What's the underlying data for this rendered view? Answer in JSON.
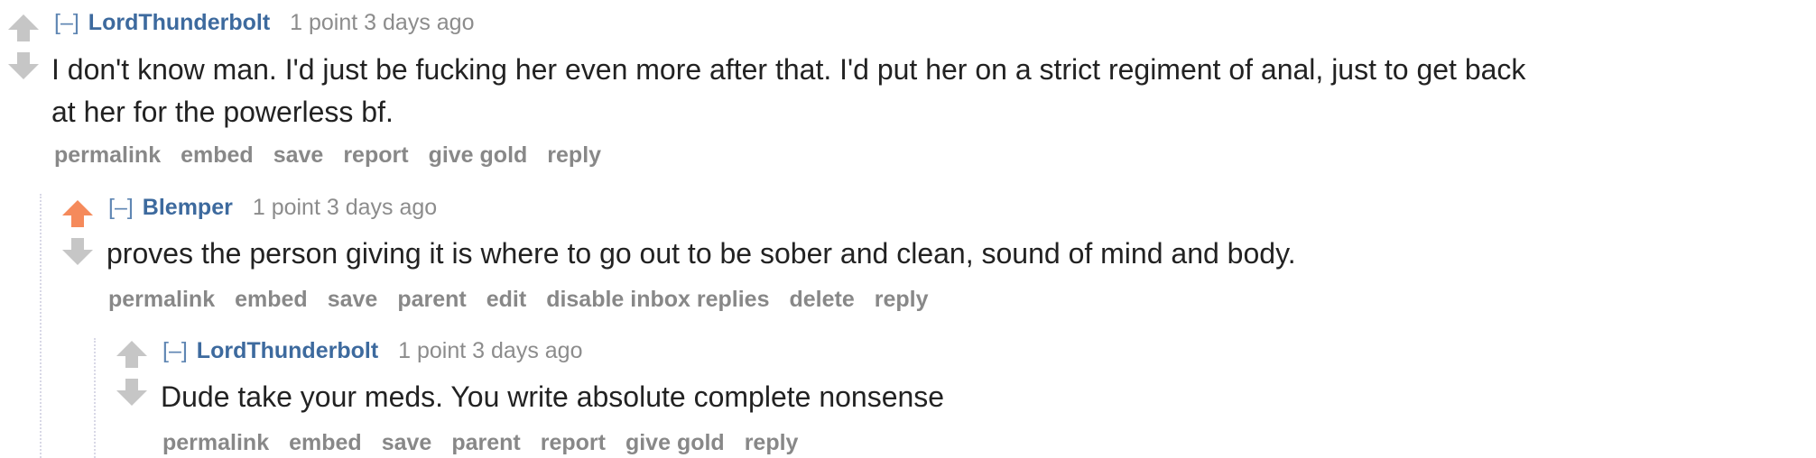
{
  "colors": {
    "upvoted_arrow": "#f58a5b",
    "arrow_gray": "#c6c6c6",
    "author_blue": "#3d6a9e",
    "expand_blue": "#5f86b3",
    "meta_gray": "#8c8c8c",
    "button_gray": "#888888",
    "thread_line": "#d8d8e6"
  },
  "comments": [
    {
      "expand": "[–]",
      "author": "LordThunderbolt",
      "score": "1 point",
      "time": "3 days ago",
      "body_line1": "I don't know man. I'd just be fucking her even more after that. I'd put her on a strict regiment of anal, just to get back",
      "body_line2": "at her for the powerless bf.",
      "upvoted": false,
      "buttons": [
        "permalink",
        "embed",
        "save",
        "report",
        "give gold",
        "reply"
      ]
    },
    {
      "expand": "[–]",
      "author": "Blemper",
      "score": "1 point",
      "time": "3 days ago",
      "body_line1": "proves the person giving it is where to go out to be sober and clean, sound of mind and body.",
      "upvoted": true,
      "buttons": [
        "permalink",
        "embed",
        "save",
        "parent",
        "edit",
        "disable inbox replies",
        "delete",
        "reply"
      ]
    },
    {
      "expand": "[–]",
      "author": "LordThunderbolt",
      "score": "1 point",
      "time": "3 days ago",
      "body_line1": "Dude take your meds. You write absolute complete nonsense",
      "upvoted": false,
      "buttons": [
        "permalink",
        "embed",
        "save",
        "parent",
        "report",
        "give gold",
        "reply"
      ]
    }
  ]
}
